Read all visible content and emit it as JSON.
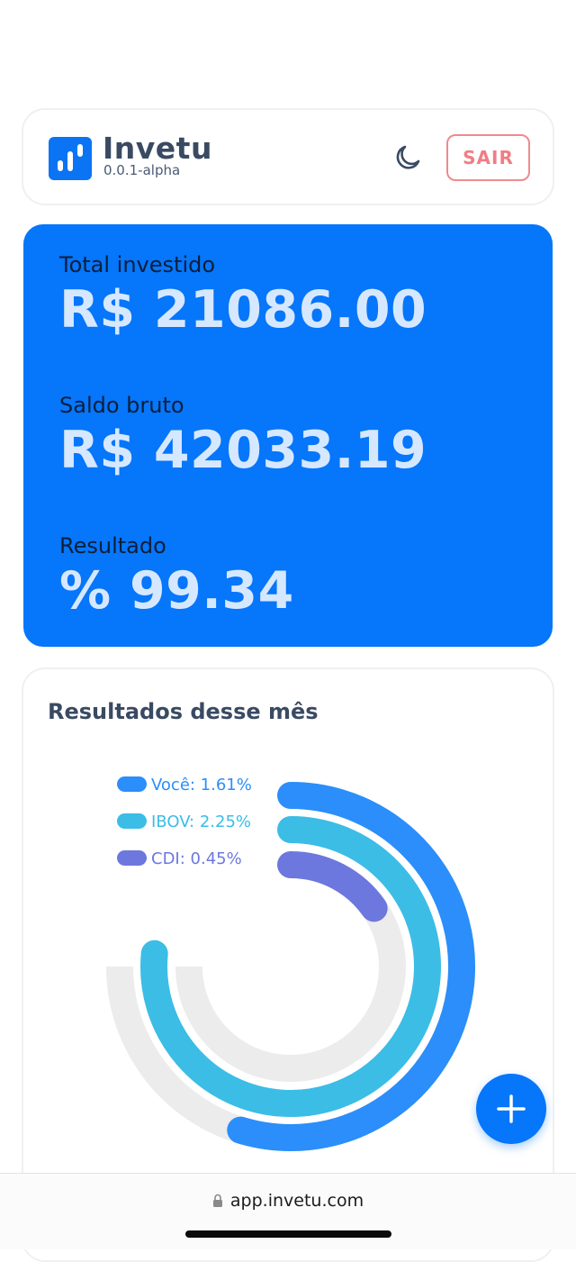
{
  "header": {
    "brand_name": "Invetu",
    "version": "0.0.1-alpha",
    "logout_label": "SAIR"
  },
  "summary": {
    "total_invested_label": "Total investido",
    "total_invested_value": "R$ 21086.00",
    "gross_balance_label": "Saldo bruto",
    "gross_balance_value": "R$ 42033.19",
    "result_label": "Resultado",
    "result_value": "% 99.34"
  },
  "results": {
    "title": "Resultados desse mês"
  },
  "chart_data": {
    "type": "radial-bar",
    "series": [
      {
        "name": "Você",
        "label": "Você: 1.61%",
        "value": 1.61,
        "color": "#2b8efa"
      },
      {
        "name": "IBOV",
        "label": "IBOV: 2.25%",
        "value": 2.25,
        "color": "#3bbde6"
      },
      {
        "name": "CDI",
        "label": "CDI: 0.45%",
        "value": 0.45,
        "color": "#6c78de"
      }
    ],
    "track_color": "#ececec",
    "legend_position": "top-left"
  },
  "browser": {
    "url": "app.invetu.com"
  },
  "colors": {
    "primary": "#0676fa",
    "danger": "#ef7e83",
    "text_dark": "#3a4a63"
  },
  "icons": {
    "theme_toggle": "moon-icon",
    "fab": "plus-icon",
    "lock": "lock-icon"
  }
}
